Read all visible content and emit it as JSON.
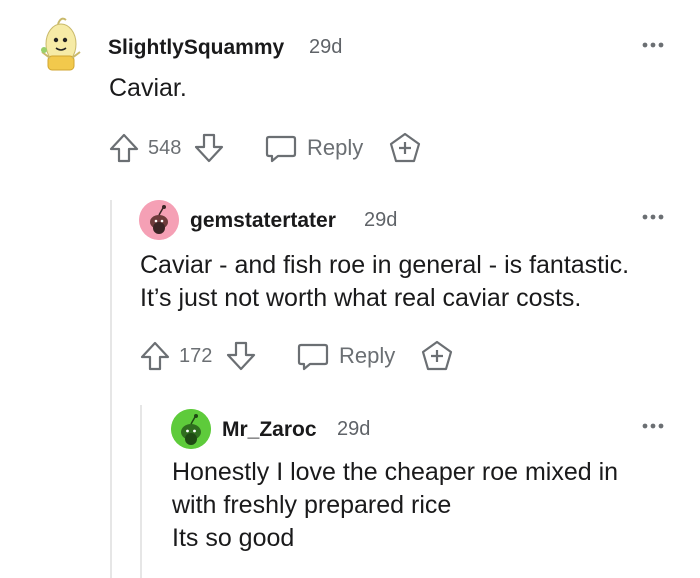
{
  "comments": [
    {
      "username": "SlightlySquammy",
      "time": "29d",
      "lines": [
        "Caviar."
      ],
      "votes": "548",
      "reply_label": "Reply"
    },
    {
      "username": "gemstatertater",
      "time": "29d",
      "lines": [
        "Caviar - and fish roe in general - is fantastic.",
        "It’s just not worth what real caviar costs."
      ],
      "votes": "172",
      "reply_label": "Reply"
    },
    {
      "username": "Mr_Zaroc",
      "time": "29d",
      "lines": [
        "Honestly I love the cheaper roe mixed in",
        "with freshly prepared rice",
        "Its so good"
      ]
    }
  ],
  "icons": {
    "more": "more-options-icon",
    "upvote": "upvote-arrow-icon",
    "downvote": "downvote-arrow-icon",
    "reply": "speech-bubble-icon",
    "award": "award-plus-icon"
  },
  "colors": {
    "avatar1": "#f4e9a8",
    "avatar2": "#f5a0b5",
    "avatar3": "#5ecb3b",
    "muted": "#6b6f73",
    "thread_line": "#e6e6e6"
  }
}
